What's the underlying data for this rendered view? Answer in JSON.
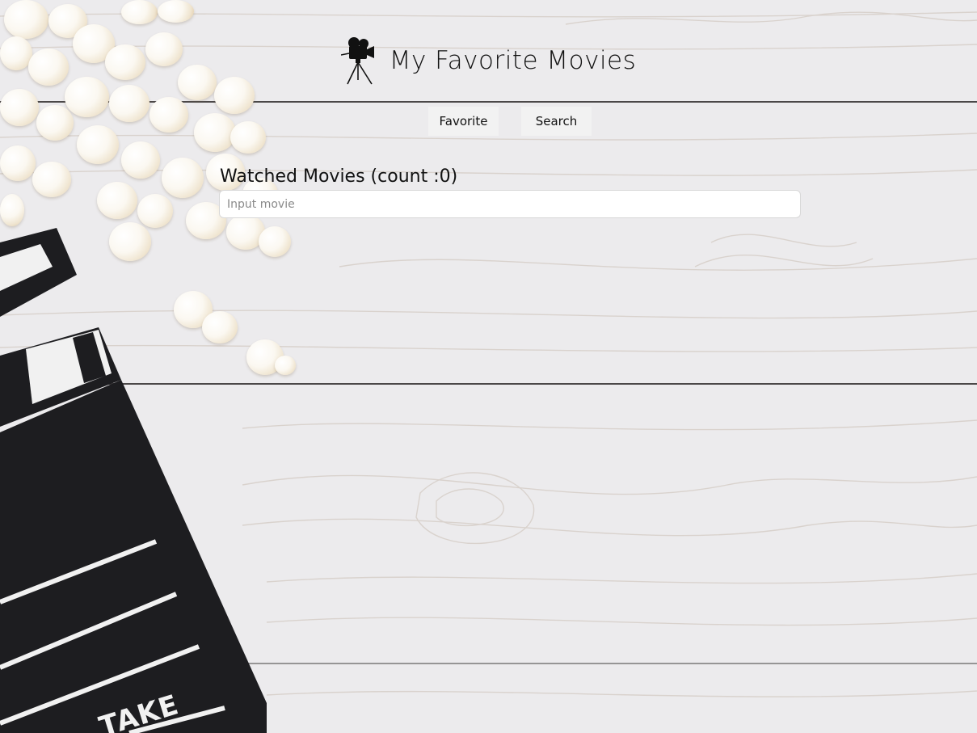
{
  "header": {
    "title": "My Favorite Movies",
    "logo_icon": "movie-camera-icon"
  },
  "nav": {
    "favorite_label": "Favorite",
    "search_label": "Search"
  },
  "watched": {
    "heading": "Watched Movies (count :0)",
    "input_placeholder": "Input movie",
    "input_value": ""
  },
  "background": {
    "clapper_text": "TAKE"
  },
  "colors": {
    "text": "#111111",
    "button_bg": "#f2f2f2",
    "wood": "#ecebed",
    "clapper": "#1d1d20"
  }
}
